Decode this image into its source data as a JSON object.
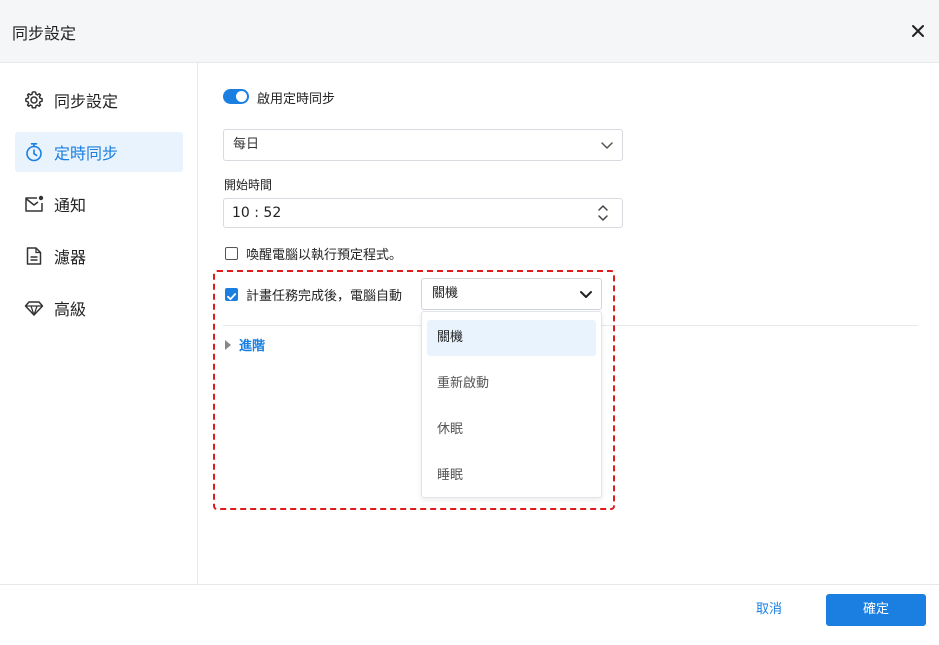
{
  "window": {
    "title": "同步設定"
  },
  "sidebar": {
    "items": [
      {
        "label": "同步設定",
        "icon": "gear-icon",
        "active": false
      },
      {
        "label": "定時同步",
        "icon": "stopwatch-icon",
        "active": true
      },
      {
        "label": "通知",
        "icon": "mail-notification-icon",
        "active": false
      },
      {
        "label": "濾器",
        "icon": "document-filter-icon",
        "active": false
      },
      {
        "label": "高級",
        "icon": "diamond-icon",
        "active": false
      }
    ]
  },
  "schedule": {
    "enable_label": "啟用定時同步",
    "enabled": true,
    "frequency_value": "每日",
    "start_time_label": "開始時間",
    "start_time_value": "10 : 52",
    "wake_label": "喚醒電腦以執行預定程式。",
    "wake_checked": false,
    "after_task_label": "計畫任務完成後，電腦自動",
    "after_task_checked": true,
    "power_action_value": "關機",
    "power_options": [
      "關機",
      "重新啟動",
      "休眠",
      "睡眠"
    ],
    "advanced_label": "進階"
  },
  "footer": {
    "cancel_label": "取消",
    "ok_label": "確定"
  },
  "colors": {
    "accent": "#1a7fe0",
    "highlight_border": "#e01b1b",
    "active_bg": "#e8f3fd"
  }
}
